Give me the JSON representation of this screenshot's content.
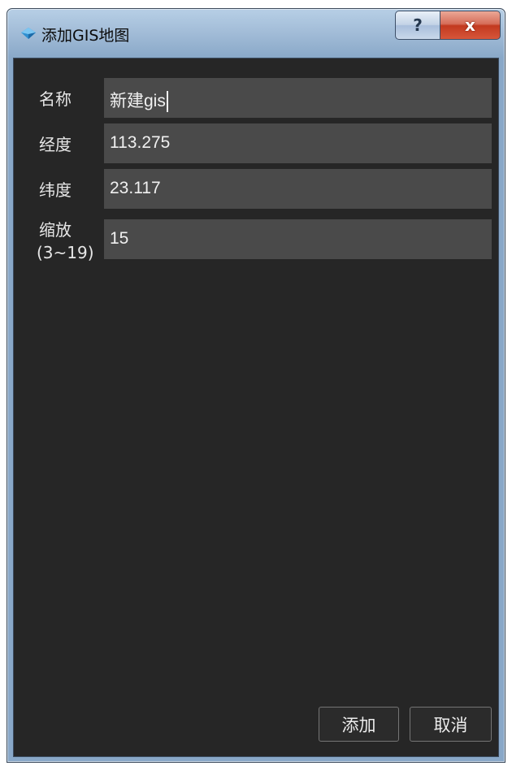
{
  "window": {
    "title": "添加GIS地图",
    "help_label": "?",
    "close_label": "x"
  },
  "form": {
    "name": {
      "label": "名称",
      "value": "新建gis"
    },
    "longitude": {
      "label": "经度",
      "value": "113.275"
    },
    "latitude": {
      "label": "纬度",
      "value": "23.117"
    },
    "zoom": {
      "label_line1": "缩放",
      "label_line2": "(3~19)",
      "value": "15"
    }
  },
  "buttons": {
    "add_label": "添加",
    "cancel_label": "取消"
  },
  "colors": {
    "client_background": "#262626",
    "field_background": "#4a4a4a",
    "text": "#e7e7e7"
  }
}
